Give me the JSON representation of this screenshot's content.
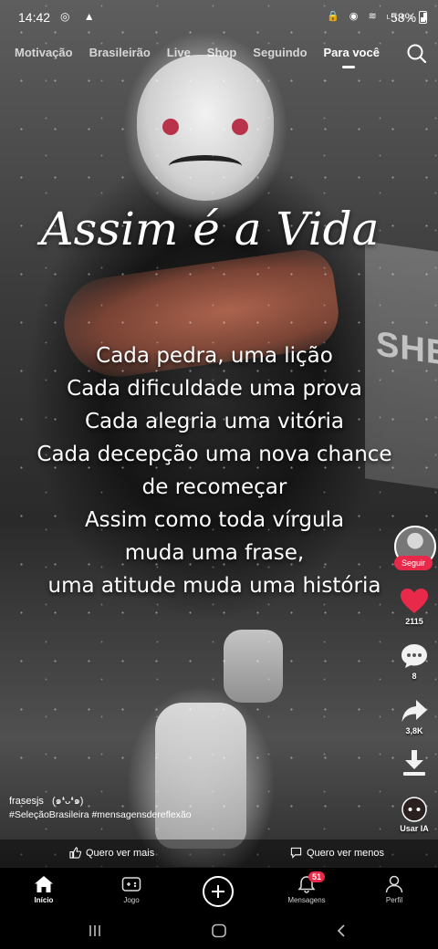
{
  "status": {
    "time": "14:42",
    "battery": "58%",
    "network": "LTE1",
    "left_icons": "◎ ▲",
    "right_icons": "🔒 ⊙ ≋ ▮"
  },
  "tabs": [
    {
      "label": "Motivação"
    },
    {
      "label": "Brasileirão"
    },
    {
      "label": "Live"
    },
    {
      "label": "Shop"
    },
    {
      "label": "Seguindo"
    },
    {
      "label": "Para você"
    }
  ],
  "active_tab": "Para você",
  "video": {
    "background_text": "SHEE",
    "title": "Assim é a Vida",
    "lines": [
      "Cada pedra, uma lição",
      "Cada dificuldade uma prova",
      "Cada alegria uma vitória",
      "Cada decepção uma nova chance",
      "de recomeçar",
      "Assim como toda vírgula",
      "muda uma frase,",
      "uma atitude muda uma história"
    ]
  },
  "actions": {
    "follow": "Seguir",
    "likes": "2115",
    "comments": "8",
    "shares": "3,8K",
    "ai_label": "Usar IA"
  },
  "author": {
    "username": "frasesjs",
    "emoticon": "(๑❛ᴗ❛๑)",
    "hashtags": "#SeleçãoBrasileira #mensagensdereflexão"
  },
  "feedback": {
    "more": "Quero ver mais",
    "less": "Quero ver menos"
  },
  "nav": {
    "home": "Início",
    "games": "Jogo",
    "messages": "Mensagens",
    "messages_badge": "51",
    "profile": "Perfil"
  },
  "colors": {
    "accent": "#e8294a",
    "background": "#000000"
  }
}
